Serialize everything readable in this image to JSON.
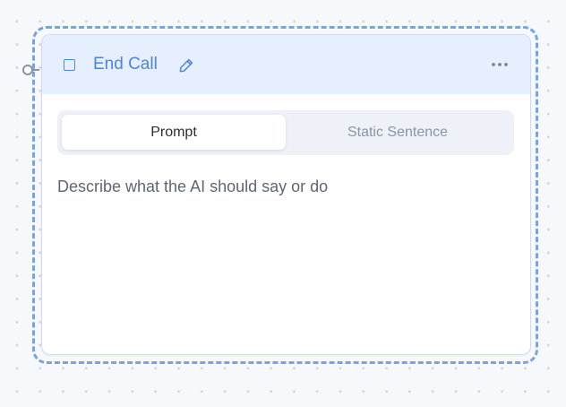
{
  "node": {
    "title": "End Call",
    "icons": {
      "type_icon": "square-stop-icon",
      "edit_icon": "pencil-icon",
      "menu_icon": "more-horizontal-icon"
    },
    "tabs": [
      {
        "label": "Prompt",
        "active": true
      },
      {
        "label": "Static Sentence",
        "active": false
      }
    ],
    "prompt": {
      "placeholder": "Describe what the AI should say or do"
    }
  },
  "colors": {
    "accent": "#4d84de",
    "header_bg": "#e6effd",
    "selection": "#74a4e5",
    "canvas_bg": "#f6f8fb"
  }
}
